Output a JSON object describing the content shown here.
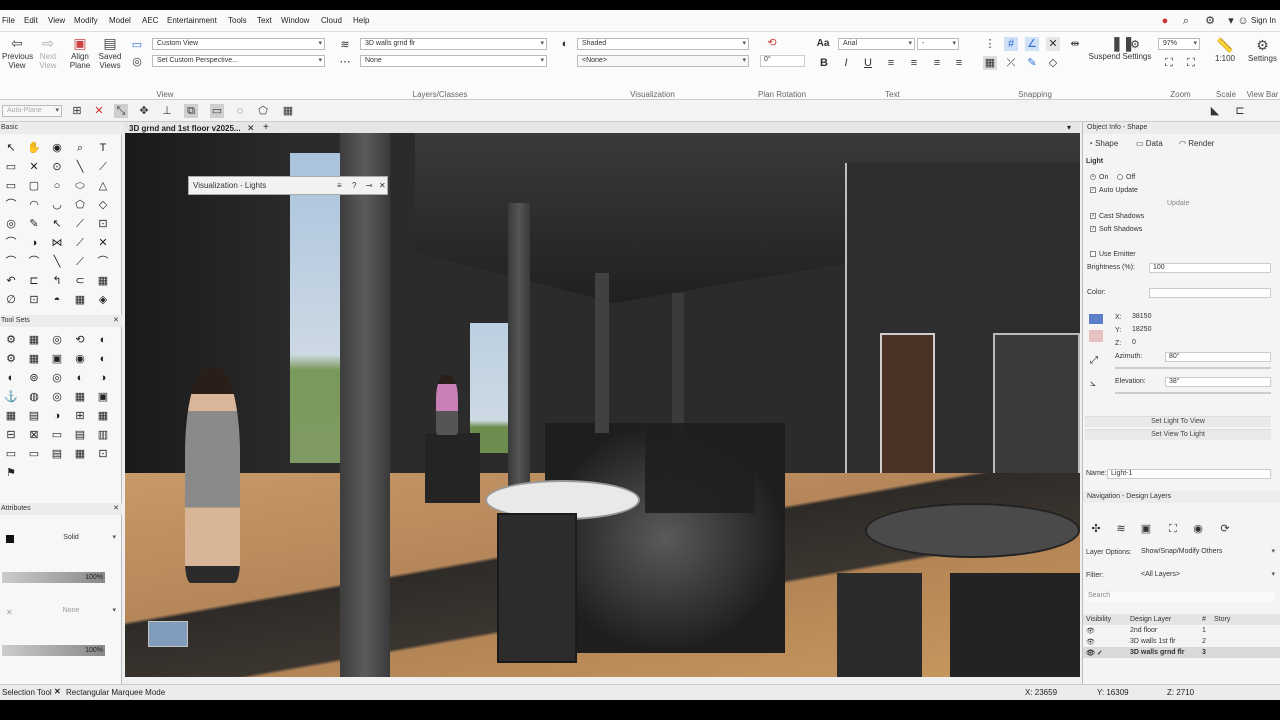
{
  "menu": [
    "File",
    "Edit",
    "View",
    "Modify",
    "Model",
    "AEC",
    "Entertainment",
    "Tools",
    "Text",
    "Window",
    "Cloud",
    "Help"
  ],
  "topright": {
    "sign_in": "Sign In"
  },
  "ribbon": {
    "previous_view": "Previous View",
    "next_view": "Next View",
    "align_plane": "Align Plane",
    "saved_views": "Saved Views",
    "view_dd": "Custom View",
    "perspective_dd": "Set Custom Perspective...",
    "layer_dd": "3D walls grnd flr",
    "class_dd": "None",
    "render_dd": "Shaded",
    "render2_dd": "<None>",
    "plan_rotation_value": "0°",
    "font_dd": "Arial",
    "size_dd": "-",
    "suspend_settings": "Suspend Settings",
    "zoom_value": "97%",
    "scale_value": "1:100",
    "settings": "Settings",
    "groups": {
      "view": "View",
      "layers_classes": "Layers/Classes",
      "visualization": "Visualization",
      "plan_rotation": "Plan Rotation",
      "text": "Text",
      "snapping": "Snapping",
      "zoom": "Zoom",
      "scale": "Scale",
      "view_bar": "View Bar"
    }
  },
  "toolbar2": {
    "plane": "Auto-Plane"
  },
  "left_palette": {
    "basic": "Basic",
    "tool_sets": "Tool Sets",
    "attributes": "Attributes",
    "fill_style": "Solid",
    "opacity1": "100%",
    "line_style": "None",
    "opacity2": "100%"
  },
  "doc_tab": "3D grnd and 1st floor v2025...",
  "viz_palette_title": "Visualization - Lights",
  "object_info": {
    "title": "Object Info - Shape",
    "tabs": [
      "Shape",
      "Data",
      "Render"
    ],
    "section": "Light",
    "on": "On",
    "off": "Off",
    "auto_update": "Auto Update",
    "update": "Update",
    "cast_shadows": "Cast Shadows",
    "soft_shadows": "Soft Shadows",
    "use_emitter": "Use Emitter",
    "brightness_label": "Brightness (%):",
    "brightness_value": "100",
    "color_label": "Color:",
    "x_label": "X:",
    "x_value": "38150",
    "y_label": "Y:",
    "y_value": "18250",
    "z_label": "Z:",
    "z_value": "0",
    "azimuth_label": "Azimuth:",
    "azimuth_value": "80°",
    "elevation_label": "Elevation:",
    "elevation_value": "38°",
    "set_light_to_view": "Set Light To View",
    "set_view_to_light": "Set View To Light",
    "name_label": "Name:",
    "name_value": "Light-1"
  },
  "navigation": {
    "title": "Navigation - Design Layers",
    "layer_options_label": "Layer Options:",
    "layer_options_value": "Show/Snap/Modify Others",
    "filter_label": "Filter:",
    "filter_value": "<All Layers>",
    "search_placeholder": "Search",
    "col_visibility": "Visibility",
    "col_design_layer": "Design Layer",
    "col_num": "#",
    "col_story": "Story",
    "layers": [
      {
        "name": "2nd floor",
        "num": "1"
      },
      {
        "name": "3D walls 1st flr",
        "num": "2"
      },
      {
        "name": "3D walls grnd flr",
        "num": "3"
      }
    ]
  },
  "status": {
    "tool": "Selection Tool",
    "mode": "Rectangular Marquee Mode",
    "x": "X: 23659",
    "y": "Y: 16309",
    "z": "Z: 2710"
  },
  "colors": {
    "accent": "#2a6fd6",
    "viewport_dark": "#1c1c1c",
    "floor_wood": "#b98b5e"
  }
}
